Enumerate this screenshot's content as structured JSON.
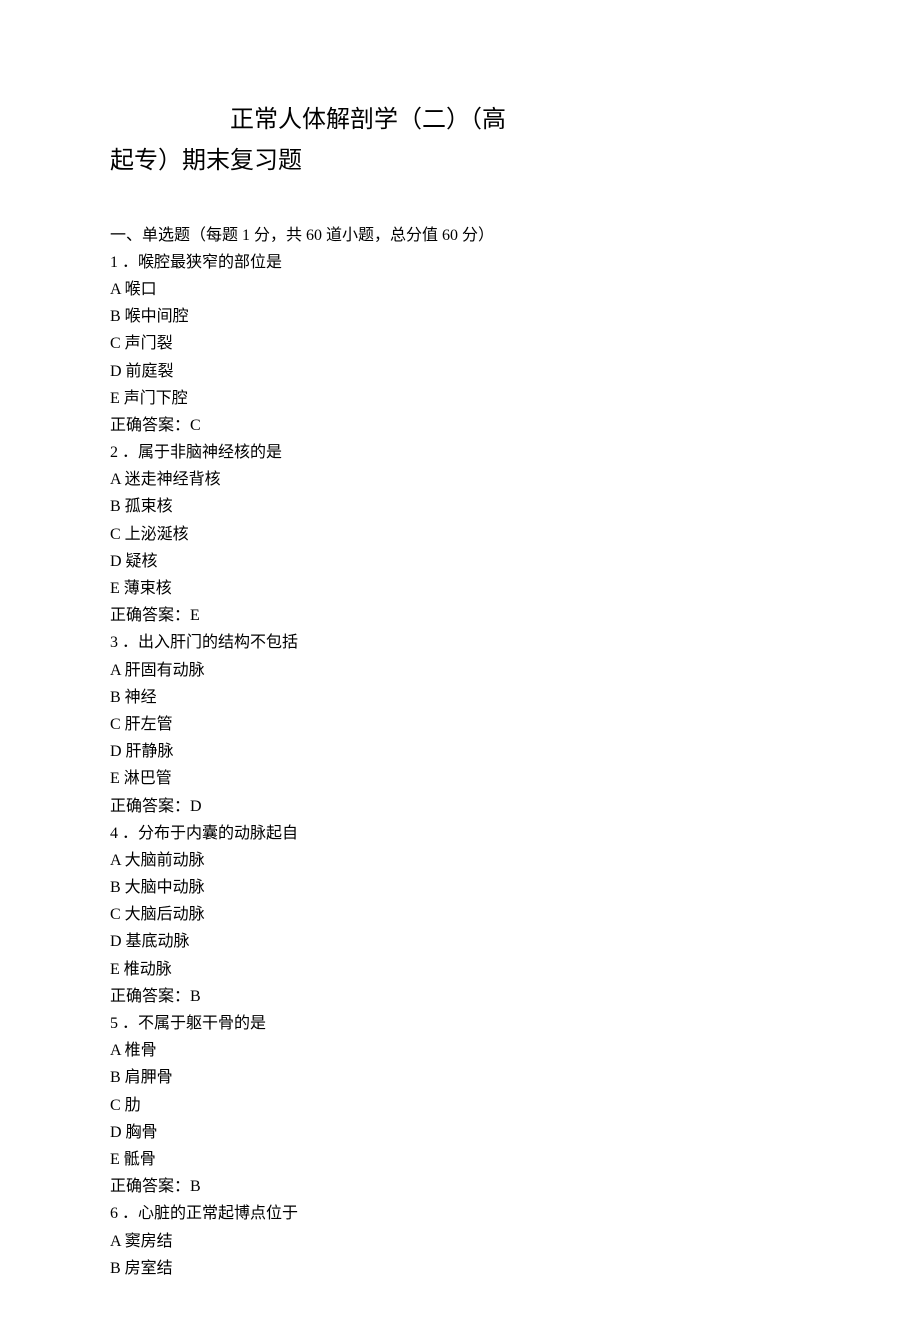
{
  "title": {
    "line1": "正常人体解剖学（二）（高",
    "line2": "起专）期末复习题"
  },
  "section_heading": "一、单选题（每题 1 分，共 60 道小题，总分值 60 分）",
  "questions": [
    {
      "number": "1",
      "stem": "．喉腔最狭窄的部位是",
      "options": [
        "A 喉口",
        "B 喉中间腔",
        "C 声门裂",
        "D 前庭裂",
        "E 声门下腔"
      ],
      "answer": "正确答案：C"
    },
    {
      "number": "2",
      "stem": "．属于非脑神经核的是",
      "options": [
        "A 迷走神经背核",
        "B 孤束核",
        "C 上泌涎核",
        "D 疑核",
        "E 薄束核"
      ],
      "answer": "正确答案：E"
    },
    {
      "number": "3",
      "stem": "．出入肝门的结构不包括",
      "options": [
        "A 肝固有动脉",
        "B 神经",
        "C 肝左管",
        "D 肝静脉",
        "E 淋巴管"
      ],
      "answer": "正确答案：D"
    },
    {
      "number": "4",
      "stem": "．分布于内囊的动脉起自",
      "options": [
        "A 大脑前动脉",
        "B 大脑中动脉",
        "C 大脑后动脉",
        "D 基底动脉",
        "E 椎动脉"
      ],
      "answer": "正确答案：B"
    },
    {
      "number": "5",
      "stem": "．不属于躯干骨的是",
      "options": [
        "A 椎骨",
        "B 肩胛骨",
        "C 肋",
        "D 胸骨",
        "E 骶骨"
      ],
      "answer": "正确答案：B"
    },
    {
      "number": "6",
      "stem": "．心脏的正常起博点位于",
      "options": [
        "A 窦房结",
        "B 房室结"
      ],
      "answer": ""
    }
  ]
}
